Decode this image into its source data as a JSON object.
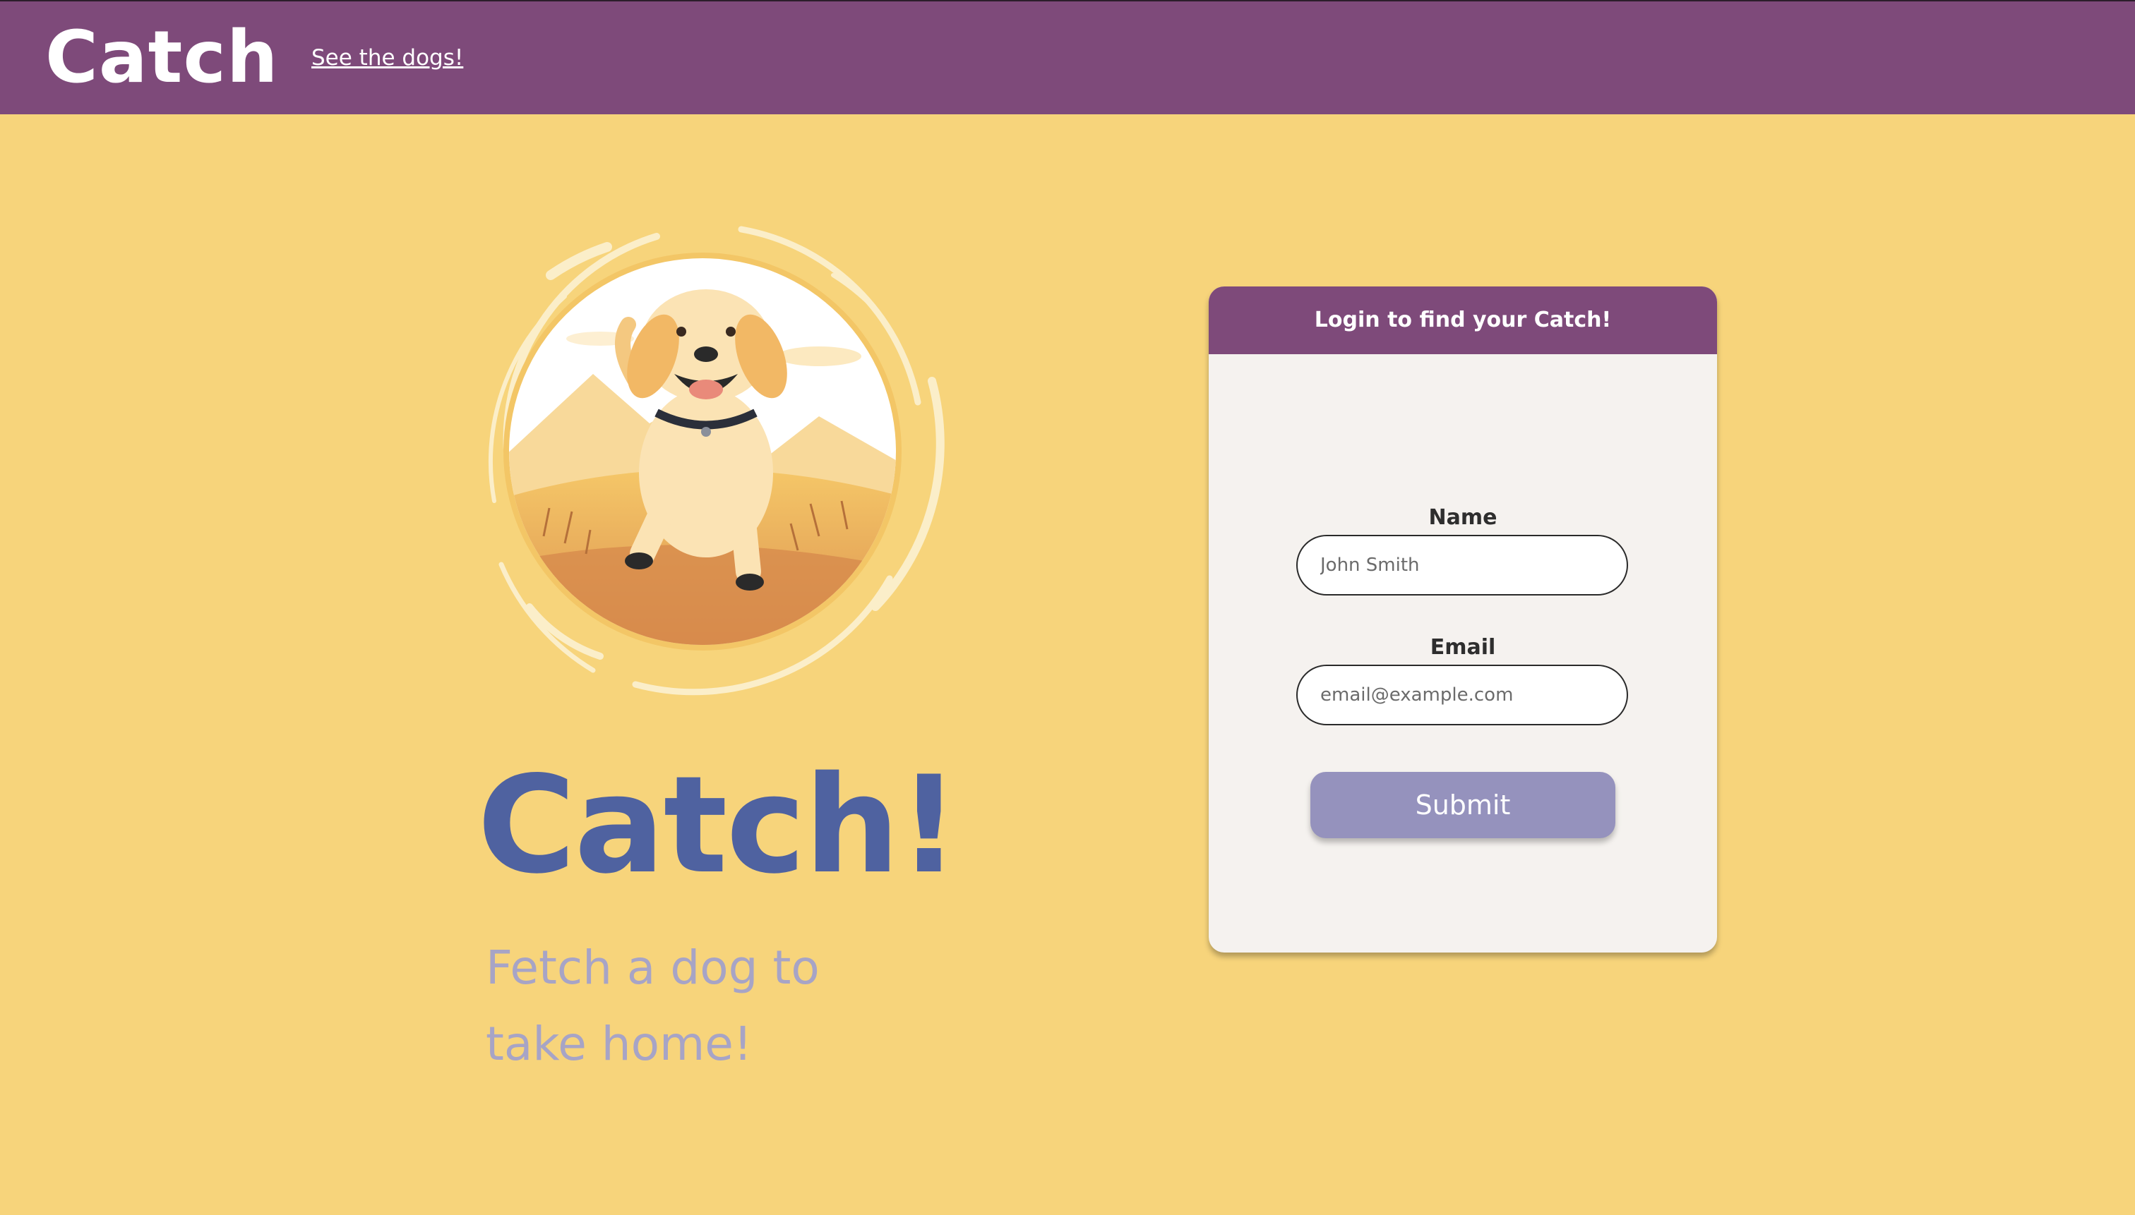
{
  "nav": {
    "brand": "Catch",
    "link_label": "See the dogs!"
  },
  "hero": {
    "image_icon": "running-puppy-illustration",
    "title": "Catch!",
    "subtitle": "Fetch a dog to take home!"
  },
  "login": {
    "header": "Login to find your Catch!",
    "name_label": "Name",
    "name_placeholder": "John Smith",
    "name_value": "",
    "email_label": "Email",
    "email_placeholder": "email@example.com",
    "email_value": "",
    "submit_label": "Submit"
  },
  "colors": {
    "page_background": "#f7d47b",
    "navbar": "#7e4a7a",
    "hero_title": "#4f62a0",
    "hero_subtitle": "#a7a4c6",
    "card_background": "#f5f2ef",
    "submit_button": "#9592bd"
  }
}
